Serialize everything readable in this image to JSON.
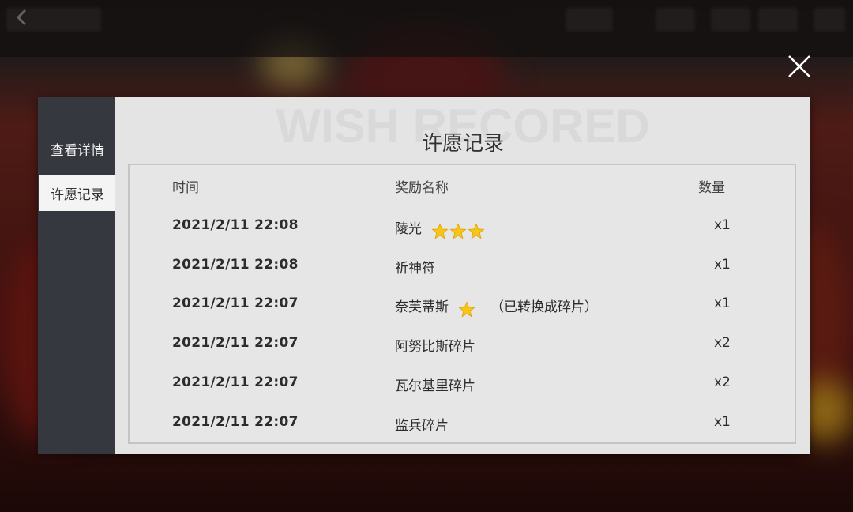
{
  "panel": {
    "watermark": "WISH RECORED",
    "title": "许愿记录"
  },
  "sidebar": {
    "items": [
      {
        "label": "查看详情",
        "active": false
      },
      {
        "label": "许愿记录",
        "active": true
      }
    ]
  },
  "table": {
    "headers": {
      "time": "时间",
      "name": "奖励名称",
      "qty": "数量"
    },
    "rows": [
      {
        "time": "2021/2/11 22:08",
        "name": "陵光",
        "stars": 3,
        "note": "",
        "qty": "x1"
      },
      {
        "time": "2021/2/11 22:08",
        "name": "祈神符",
        "stars": 0,
        "note": "",
        "qty": "x1"
      },
      {
        "time": "2021/2/11 22:07",
        "name": "奈芙蒂斯",
        "stars": 1,
        "note": "（已转换成碎片）",
        "qty": "x1"
      },
      {
        "time": "2021/2/11 22:07",
        "name": "阿努比斯碎片",
        "stars": 0,
        "note": "",
        "qty": "x2"
      },
      {
        "time": "2021/2/11 22:07",
        "name": "瓦尔基里碎片",
        "stars": 0,
        "note": "",
        "qty": "x2"
      },
      {
        "time": "2021/2/11 22:07",
        "name": "监兵碎片",
        "stars": 0,
        "note": "",
        "qty": "x1"
      }
    ]
  },
  "icons": {
    "close": "close-icon",
    "back": "back-arrow-icon",
    "star": "star-icon"
  },
  "colors": {
    "sidebar": "#363840",
    "panel": "#e4e4e4",
    "star": "#f5c518"
  }
}
